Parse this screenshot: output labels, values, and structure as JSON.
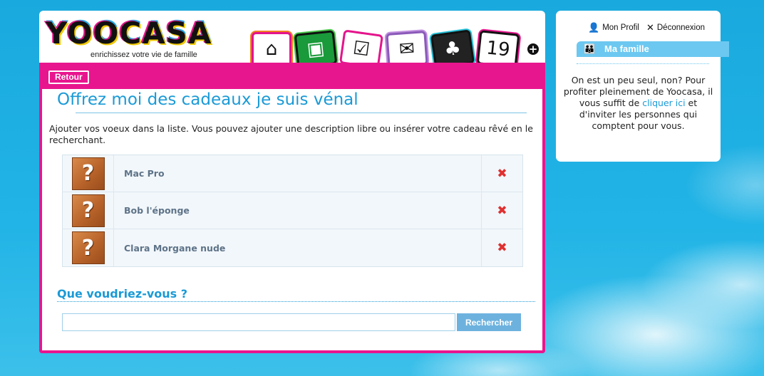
{
  "brand": {
    "logo_text": "YOOCASA",
    "tagline": "enrichissez votre vie de famille"
  },
  "app_icons": [
    {
      "name": "home-icon",
      "glyph": "⌂"
    },
    {
      "name": "photo-icon",
      "glyph": "▣"
    },
    {
      "name": "notes-icon",
      "glyph": "☑"
    },
    {
      "name": "mail-icon",
      "glyph": "✉"
    },
    {
      "name": "cards-icon",
      "glyph": "♣"
    },
    {
      "name": "calendar-icon",
      "glyph": "19"
    }
  ],
  "toolbar": {
    "back_label": "Retour"
  },
  "page": {
    "title": "Offrez moi des cadeaux je suis vénal",
    "intro": "Ajouter vos voeux dans la liste. Vous pouvez ajouter une description libre ou insérer votre cadeau rêvé en le recherchant."
  },
  "wishlist": {
    "items": [
      {
        "name": "Mac Pro"
      },
      {
        "name": "Bob l'éponge"
      },
      {
        "name": "Clara Morgane nude"
      }
    ],
    "thumb_placeholder": "?",
    "delete_glyph": "✖"
  },
  "search": {
    "heading": "Que voudriez-vous ?",
    "value": "",
    "button_label": "Rechercher"
  },
  "sidebar": {
    "profile_label": "Mon Profil",
    "logout_label": "Déconnexion",
    "family_tab_label": "Ma famille",
    "message_before": "On est un peu seul, non? Pour profiter pleinement de Yoocasa, il vous suffit de ",
    "message_link": "cliquer ici",
    "message_after": " et d'inviter les personnes qui comptent pour vous."
  },
  "colors": {
    "accent_pink": "#e8168e",
    "accent_blue": "#1a9ad6",
    "sky_blue": "#1fb0e3",
    "delete_red": "#e03030"
  }
}
